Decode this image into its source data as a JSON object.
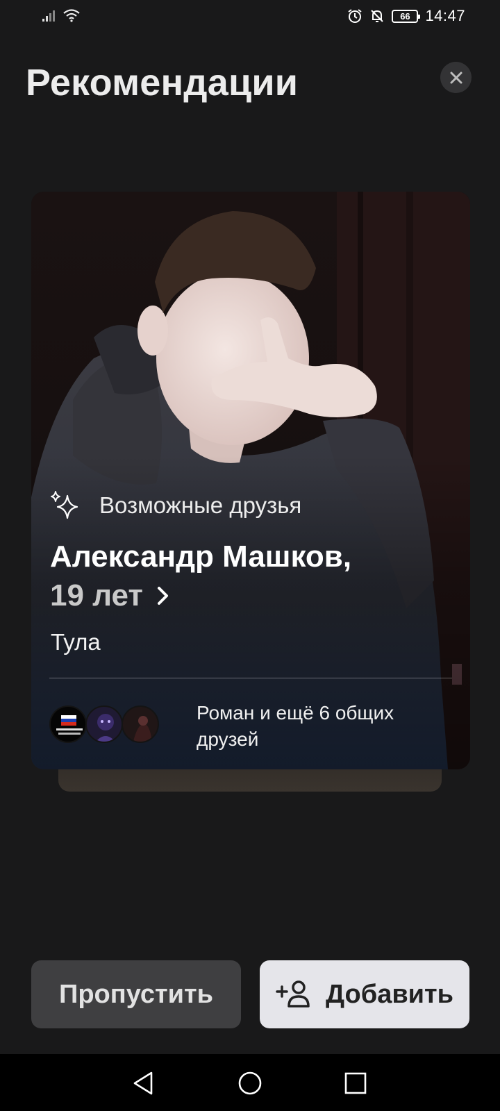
{
  "status_bar": {
    "time": "14:47",
    "battery": "66",
    "icons": [
      "signal-icon",
      "wifi-icon",
      "alarm-icon",
      "mute-icon",
      "battery-icon"
    ]
  },
  "header": {
    "title": "Рекомендации",
    "close_icon": "close-icon"
  },
  "card": {
    "recommendation_label": "Возможные друзья",
    "recommendation_icon": "sparkles-icon",
    "name": "Александр Машков,",
    "age": "19 лет",
    "city": "Тула",
    "mutual_friends_text": "Роман и ещё 6 общих друзей",
    "mutual_avatars": [
      "avatar-1",
      "avatar-2",
      "avatar-3"
    ]
  },
  "actions": {
    "skip_label": "Пропустить",
    "add_label": "Добавить",
    "add_icon": "add-user-icon"
  },
  "nav": {
    "back_icon": "back-icon",
    "home_icon": "home-icon",
    "recents_icon": "recents-icon"
  },
  "colors": {
    "background": "#19191a",
    "button_secondary": "#3f3f41",
    "button_primary": "#e5e5ea"
  }
}
